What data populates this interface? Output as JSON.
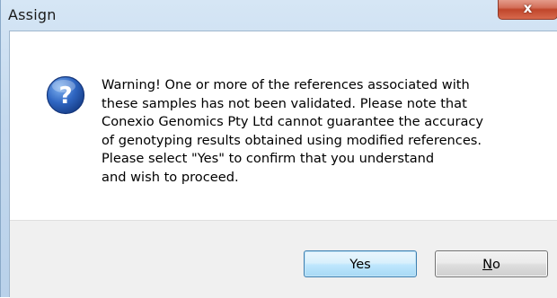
{
  "window": {
    "title": "Assign",
    "close_glyph": "x"
  },
  "dialog": {
    "icon": "question-icon",
    "icon_glyph": "?",
    "message_lines": [
      "Warning! One or more of the references associated with",
      "these samples has not been validated. Please note that",
      "Conexio Genomics Pty Ltd cannot guarantee the accuracy",
      "of genotyping results obtained using modified references.",
      "Please select \"Yes\" to confirm that you understand",
      "and wish to proceed."
    ]
  },
  "buttons": {
    "yes_label": "Yes",
    "no_mnemonic": "N",
    "no_rest": "o"
  },
  "colors": {
    "question_icon_fill": "#2a5db0",
    "close_button": "#c7503a",
    "default_button_border": "#3c7fb1"
  }
}
